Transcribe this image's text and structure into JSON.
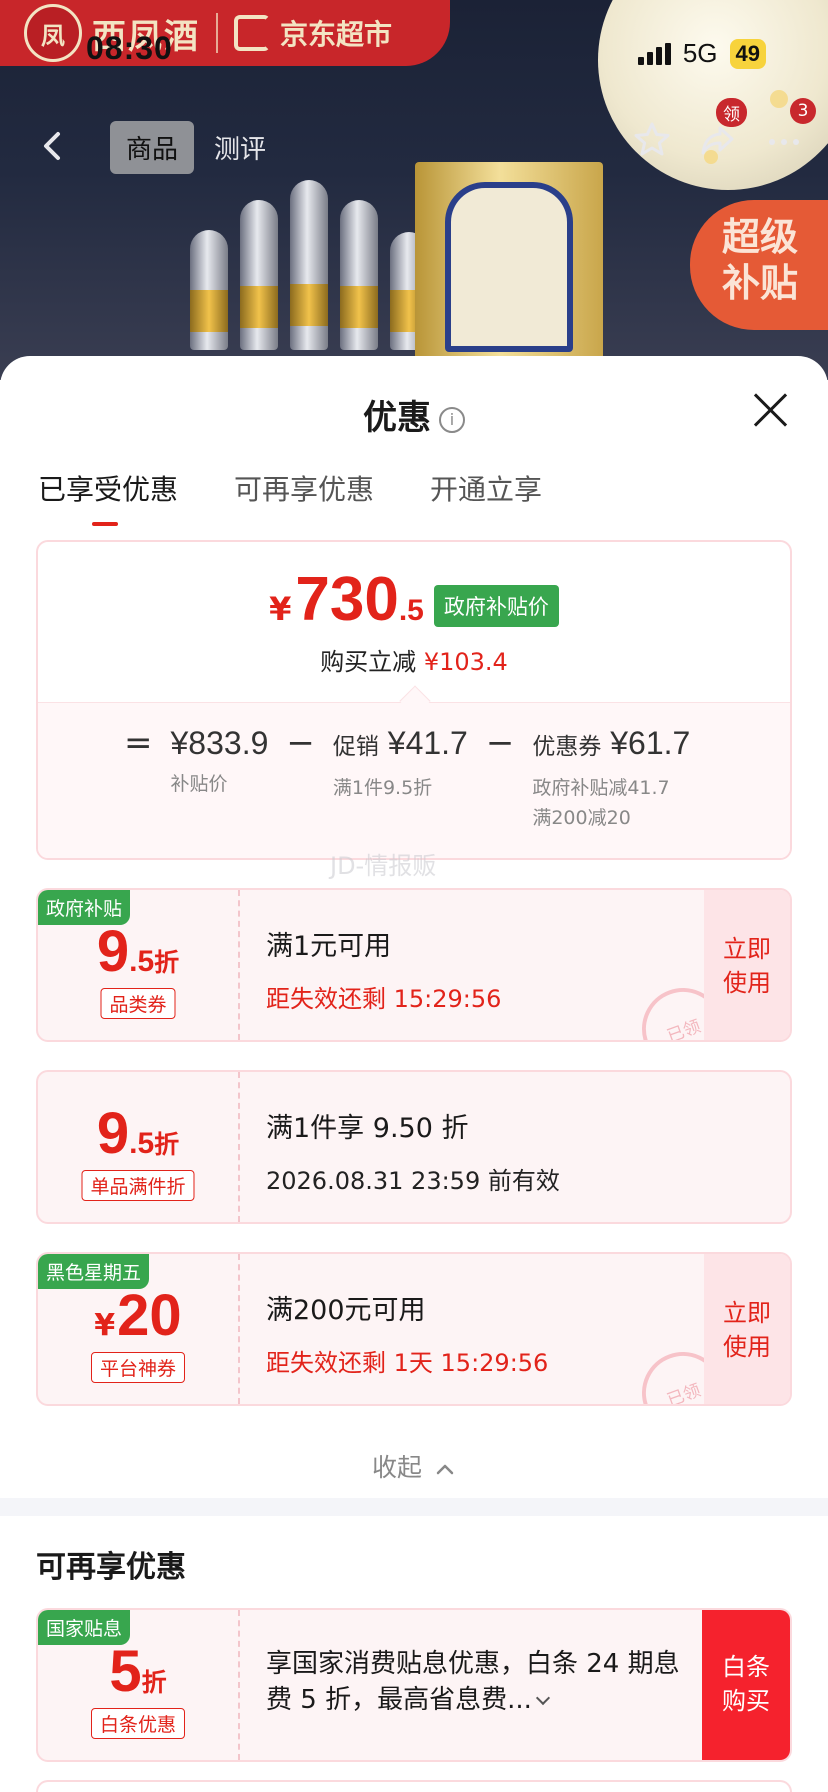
{
  "status": {
    "time": "08:30",
    "network": "5G",
    "battery": "49"
  },
  "brand": {
    "name": "西凤酒",
    "shop": "京东超市",
    "logo_icon": "brand-seal-icon"
  },
  "nav": {
    "tabs": [
      "商品",
      "测评"
    ],
    "active_tab": 0,
    "badge_coupon": "领",
    "badge_count": "3"
  },
  "hero": {
    "super_subsidy": "超级补贴"
  },
  "sheet": {
    "title": "优惠",
    "tabs": [
      "已享受优惠",
      "可再享优惠",
      "开通立享"
    ],
    "active_tab": 0
  },
  "summary": {
    "yen": "¥",
    "price_int": "730",
    "price_dec": ".5",
    "tag": "政府补贴价",
    "reduce_label": "购买立减",
    "reduce_value": "¥103.4",
    "eq": "=",
    "subsidy_price": "¥833.9",
    "subsidy_price_label": "补贴价",
    "minus1": "−",
    "promo_label": "促销",
    "promo_value": "¥41.7",
    "promo_note": "满1件9.5折",
    "minus2": "−",
    "coupon_label": "优惠券",
    "coupon_value": "¥61.7",
    "coupon_note1": "政府补贴减41.7",
    "coupon_note2": "满200减20"
  },
  "watermark": "JD-情报贩",
  "coupons": [
    {
      "tag": "政府补贴",
      "num": "9",
      "dec": ".5",
      "unit": "折",
      "type": "品类券",
      "title": "满1元可用",
      "sub": "距失效还剩 15:29:56",
      "action": "立即\n使用",
      "stamp": "已领"
    },
    {
      "tag": "",
      "num": "9",
      "dec": ".5",
      "unit": "折",
      "type": "单品满件折",
      "title": "满1件享 9.50 折",
      "sub": "2026.08.31 23:59 前有效"
    },
    {
      "tag": "黑色星期五",
      "yen": "¥",
      "num": "20",
      "type": "平台神券",
      "title": "满200元可用",
      "sub": "距失效还剩 1天 15:29:56",
      "action": "立即\n使用",
      "stamp": "已领"
    }
  ],
  "collapse_label": "收起",
  "section2": {
    "title": "可再享优惠",
    "coupon": {
      "tag": "国家贴息",
      "num": "5",
      "unit": "折",
      "type": "白条优惠",
      "text": "享国家消费贴息优惠，白条 24 期息费 5 折，最高省息费...",
      "action": "白条\n购买"
    }
  },
  "colors": {
    "accent_red": "#e2231a",
    "gov_green": "#38a64e",
    "card_border": "#fbd9dd"
  }
}
